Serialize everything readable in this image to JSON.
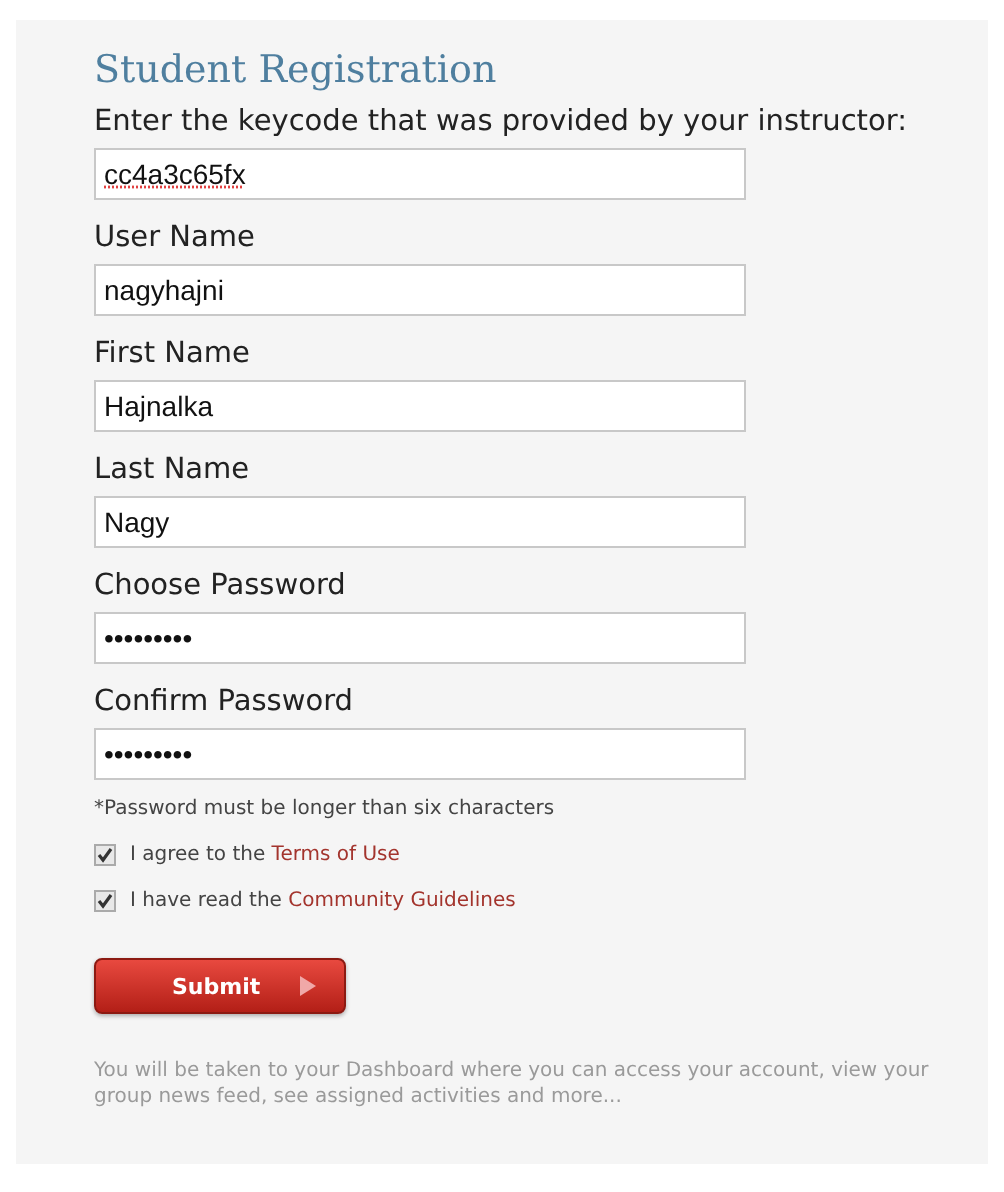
{
  "title": "Student Registration",
  "fields": [
    {
      "label": "Enter the keycode that was provided by your instructor:",
      "value": "cc4a3c65fx",
      "spellcheck_error": true
    },
    {
      "label": "User Name",
      "value": "nagyhajni",
      "spellcheck_error": false
    },
    {
      "label": "First Name",
      "value": "Hajnalka",
      "spellcheck_error": false
    },
    {
      "label": "Last Name",
      "value": "Nagy",
      "spellcheck_error": false
    },
    {
      "label": "Choose Password",
      "value": "•••••••••",
      "spellcheck_error": false
    },
    {
      "label": "Confirm Password",
      "value": "•••••••••",
      "spellcheck_error": false
    }
  ],
  "password_note": "*Password must be longer than six characters",
  "agreements": [
    {
      "text": "I agree to the",
      "link": "Terms of Use",
      "checked": true
    },
    {
      "text": "I have read the",
      "link": "Community Guidelines",
      "checked": true
    }
  ],
  "submit_button": {
    "label": "Submit"
  },
  "footer_note": "You will be taken to your Dashboard where you can access your account, view your group news feed, see assigned activities and more..."
}
